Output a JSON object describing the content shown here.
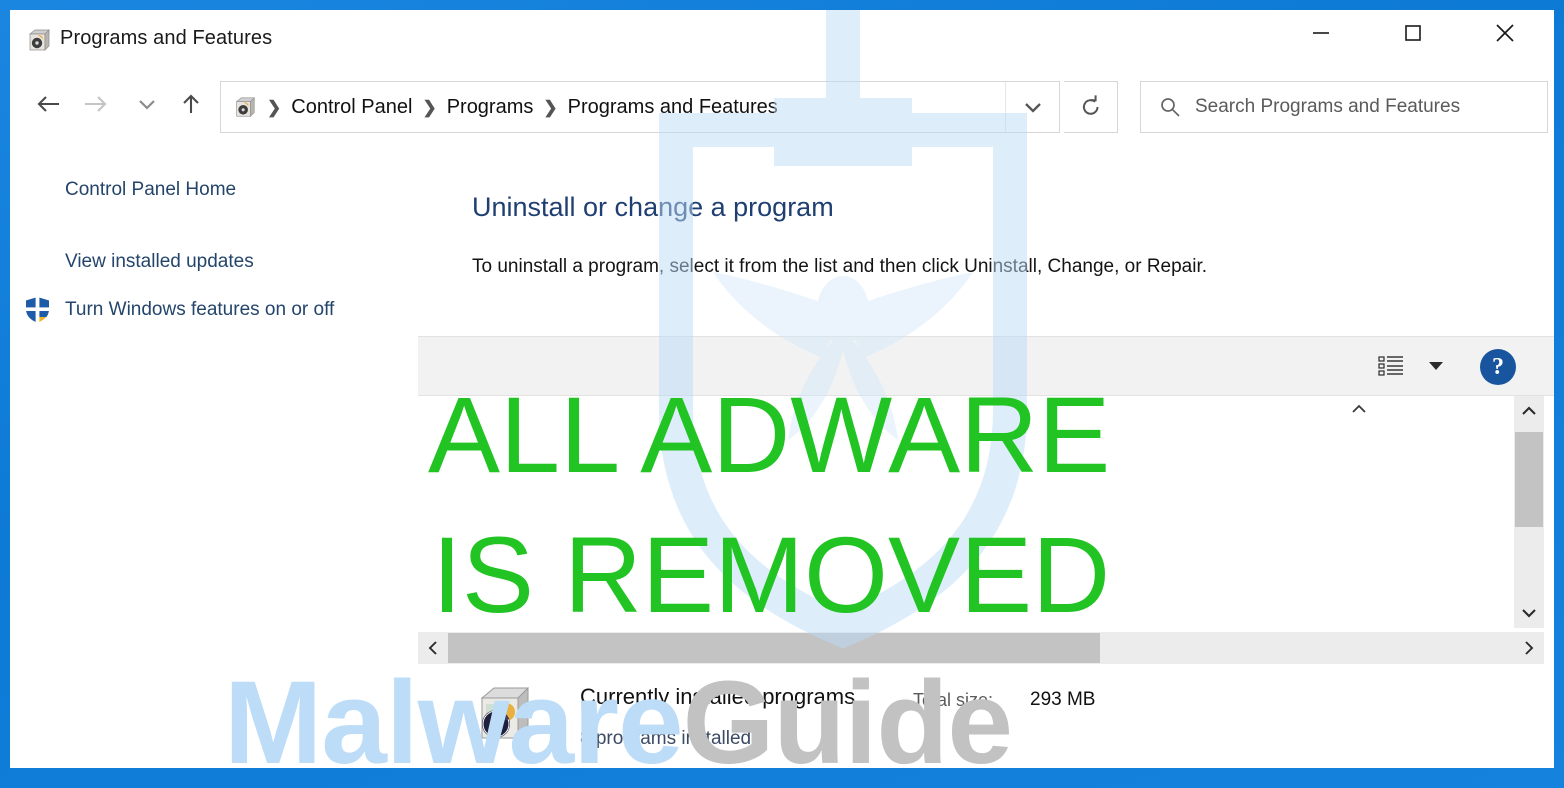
{
  "window": {
    "title": "Programs and Features",
    "title_icon": "programs-and-features-icon",
    "minimize_label": "—",
    "maximize_label": "□",
    "close_label": "✕",
    "frame_color": "#1a86e0"
  },
  "nav": {
    "back_icon": "arrow-left-icon",
    "forward_icon": "arrow-right-icon",
    "recent_icon": "chevron-down-icon",
    "up_icon": "arrow-up-icon",
    "refresh_icon": "refresh-icon",
    "breadcrumb_icon": "programs-and-features-icon",
    "breadcrumb": [
      "Control Panel",
      "Programs",
      "Programs and Features"
    ],
    "separator": "❯",
    "dropdown_icon": "chevron-down-icon"
  },
  "search": {
    "placeholder": "Search Programs and Features",
    "value": "",
    "icon": "search-icon"
  },
  "sidebar": {
    "items": [
      {
        "label": "Control Panel Home",
        "icon": null
      },
      {
        "label": "View installed updates",
        "icon": null
      },
      {
        "label": "Turn Windows features on or off",
        "icon": "uac-shield-icon"
      }
    ]
  },
  "main": {
    "heading": "Uninstall or change a program",
    "description": "To uninstall a program, select it from the list and then click Uninstall, Change, or Repair.",
    "heading_color": "#1f3e72"
  },
  "toolbar": {
    "view_icon": "list-view-icon",
    "view_caret_icon": "chevron-down-icon",
    "help_label": "?",
    "help_icon": "help-circle-icon",
    "help_color": "#19559e"
  },
  "scrollbars": {
    "vertical": {
      "up_icon": "chevron-up-icon",
      "down_icon": "chevron-down-icon"
    },
    "horizontal": {
      "left_icon": "chevron-left-icon",
      "right_icon": "chevron-right-icon"
    },
    "list_sort_icon": "chevron-up-icon"
  },
  "status": {
    "icon": "currently-installed-programs-icon",
    "title": "Currently installed programs",
    "total_size_label": "Total size:",
    "total_size_value": "293 MB",
    "program_count": "8 programs installed"
  },
  "overlay": {
    "line1": "ALL ADWARE",
    "line2": "IS REMOVED",
    "color": "#21c423"
  },
  "watermark": {
    "text_part1": "Malware",
    "text_part2": "Guide",
    "color1": "#bcdcf7",
    "color2": "#c2c2c2",
    "logo_icon": "shield-wings-logo-watermark"
  }
}
